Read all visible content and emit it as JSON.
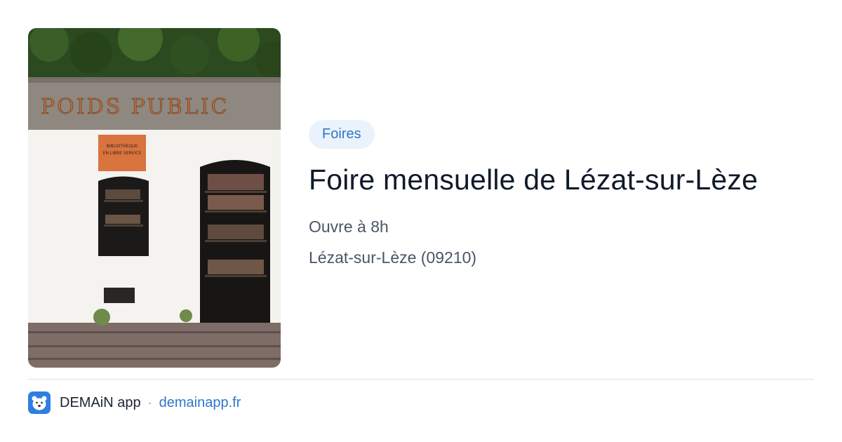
{
  "card": {
    "image": {
      "sign_text": "POIDS PUBLIC",
      "plaque_line1": "BIBLIOTHEQUE",
      "plaque_line2": "EN LIBRE SERVICE"
    },
    "category": "Foires",
    "title": "Foire mensuelle de Lézat-sur-Lèze",
    "hours": "Ouvre à 8h",
    "location": "Lézat-sur-Lèze (09210)"
  },
  "footer": {
    "app_name": "DEMAiN app",
    "separator": "·",
    "link": "demainapp.fr",
    "logo_icon": "bear-face-icon"
  },
  "colors": {
    "badge_bg": "#eaf2fb",
    "accent": "#2f77c9",
    "title": "#0f1a2b",
    "subtitle": "#4a5565",
    "logo_bg": "#2d7fe0"
  }
}
